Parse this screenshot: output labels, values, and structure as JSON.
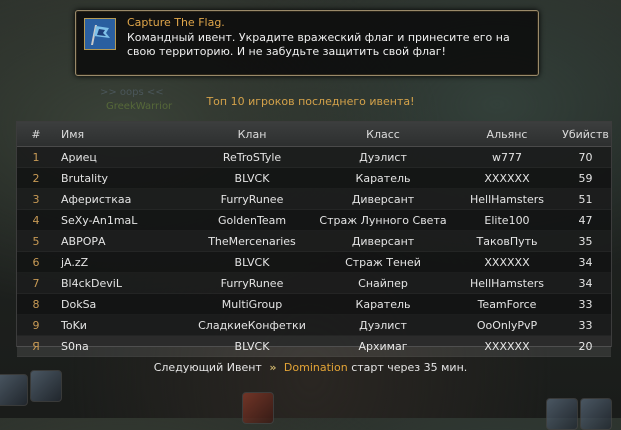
{
  "notification": {
    "title": "Capture The Flag.",
    "message": "Командный ивент. Украдите вражеский флаг и принесите его на свою территорию. И не забудьте защитить свой флаг!",
    "icon": "flag-event-icon"
  },
  "scoreboard": {
    "title": "Топ 10 игроков последнего ивента!",
    "columns": [
      "#",
      "Имя",
      "Клан",
      "Класс",
      "Альянс",
      "Убийств"
    ],
    "rows": [
      {
        "rank": "1",
        "name": "Ариец",
        "clan": "ReTroSTyle",
        "class": "Дуэлист",
        "alliance": "w777",
        "kills": "70"
      },
      {
        "rank": "2",
        "name": "Brutality",
        "clan": "BLVCK",
        "class": "Каратель",
        "alliance": "XXXXXX",
        "kills": "59"
      },
      {
        "rank": "3",
        "name": "Аферисткаа",
        "clan": "FurryRunee",
        "class": "Диверсант",
        "alliance": "HellHamsters",
        "kills": "51"
      },
      {
        "rank": "4",
        "name": "SeXy-An1maL",
        "clan": "GoldenTeam",
        "class": "Страж Лунного Света",
        "alliance": "Elite100",
        "kills": "47"
      },
      {
        "rank": "5",
        "name": "АВРОРА",
        "clan": "TheMercenaries",
        "class": "Диверсант",
        "alliance": "ТаковПуть",
        "kills": "35"
      },
      {
        "rank": "6",
        "name": "jA.zZ",
        "clan": "BLVCK",
        "class": "Страж Теней",
        "alliance": "XXXXXX",
        "kills": "34"
      },
      {
        "rank": "7",
        "name": "Bl4ckDeviL",
        "clan": "FurryRunee",
        "class": "Снайпер",
        "alliance": "HellHamsters",
        "kills": "34"
      },
      {
        "rank": "8",
        "name": "DokSa",
        "clan": "MultiGroup",
        "class": "Каратель",
        "alliance": "TeamForce",
        "kills": "33"
      },
      {
        "rank": "9",
        "name": "ToKи",
        "clan": "СладкиеКонфетки",
        "class": "Дуэлист",
        "alliance": "OoOnlyPvP",
        "kills": "33"
      }
    ],
    "me": {
      "rank": "Я",
      "name": "S0na",
      "clan": "BLVCK",
      "class": "Архимаг",
      "alliance": "XXXXXX",
      "kills": "20"
    }
  },
  "next_event": {
    "prefix": "Следующий Ивент",
    "arrows": "»",
    "event_name": "Domination",
    "suffix": "старт через 35 мин."
  },
  "background": {
    "label1": ">> oops <<",
    "label2": "GreekWarrior"
  }
}
